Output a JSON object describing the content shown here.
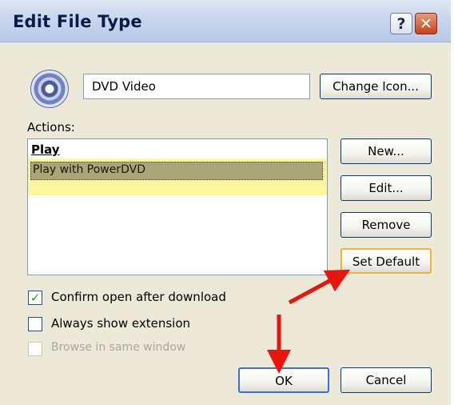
{
  "window": {
    "title": "Edit File Type",
    "help_label": "?",
    "close_label": "✕"
  },
  "file_type": {
    "icon": "dvd-disc-icon",
    "name_value": "DVD Video",
    "change_icon_label": "Change Icon..."
  },
  "actions": {
    "label": "Actions:",
    "items": [
      {
        "label": "Play",
        "default": true,
        "selected": false
      },
      {
        "label": "Play with PowerDVD",
        "default": false,
        "selected": true
      }
    ],
    "buttons": {
      "new": "New...",
      "edit": "Edit...",
      "remove": "Remove",
      "set_default": "Set Default"
    }
  },
  "options": [
    {
      "label": "Confirm open after download",
      "checked": true,
      "enabled": true
    },
    {
      "label": "Always show extension",
      "checked": false,
      "enabled": true
    },
    {
      "label": "Browse in same window",
      "checked": false,
      "enabled": false
    }
  ],
  "footer": {
    "ok": "OK",
    "cancel": "Cancel"
  },
  "annotations": {
    "arrow_color": "#e8150c",
    "highlight_color": "#fff68a"
  }
}
